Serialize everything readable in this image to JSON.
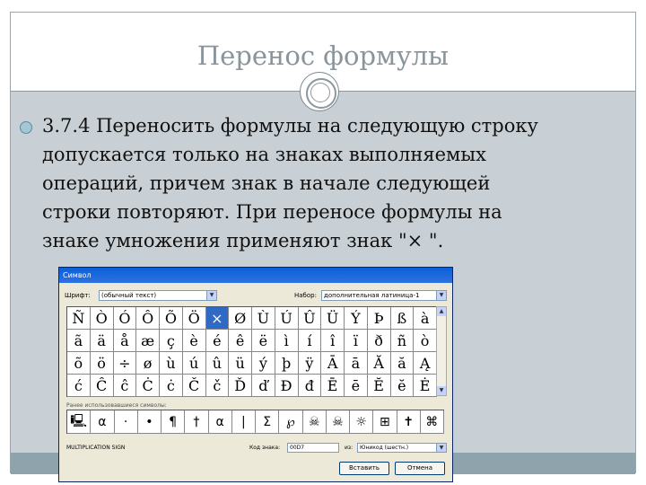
{
  "slide": {
    "title": "Перенос формулы",
    "bullet": "3.7.4 Переносить формулы на следующую строку\nдопускается только на знаках выполняемых\nопераций, причем знак в начале следующей\nстроки повторяют. При переносе формулы на\nзнаке умножения применяют знак \"× \"."
  },
  "dialog": {
    "title": "Символ",
    "font_label": "Шрифт:",
    "font_value": "(обычный текст)",
    "subset_label": "Набор:",
    "subset_value": "дополнительная латиница-1",
    "symbols": [
      "Ñ",
      "Ò",
      "Ó",
      "Ô",
      "Õ",
      "Ö",
      "×",
      "Ø",
      "Ù",
      "Ú",
      "Û",
      "Ü",
      "Ý",
      "Þ",
      "ß",
      "à",
      "ã",
      "ä",
      "å",
      "æ",
      "ç",
      "è",
      "é",
      "ê",
      "ë",
      "ì",
      "í",
      "î",
      "ï",
      "ð",
      "ñ",
      "ò",
      "õ",
      "ö",
      "÷",
      "ø",
      "ù",
      "ú",
      "û",
      "ü",
      "ý",
      "þ",
      "ÿ",
      "Ā",
      "ā",
      "Ă",
      "ă",
      "Ą",
      "ć",
      "Ĉ",
      "ĉ",
      "Ċ",
      "ċ",
      "Č",
      "č",
      "Ď",
      "ď",
      "Đ",
      "đ",
      "Ē",
      "ē",
      "Ĕ",
      "ĕ",
      "Ė"
    ],
    "selected_index": 6,
    "recent_label": "Ранее использовавшиеся символы:",
    "recent": [
      "🖳",
      "α",
      "·",
      "•",
      "¶",
      "†",
      "α",
      "|",
      "Σ",
      "℘",
      "☠",
      "☠",
      "☼",
      "⊞",
      "✝",
      "⌘"
    ],
    "char_name": "MULTIPLICATION SIGN",
    "code_label": "Код знака:",
    "code_value": "00D7",
    "from_label": "из:",
    "from_value": "Юникод (шестн.)",
    "insert_label": "Вставить",
    "cancel_label": "Отмена"
  }
}
